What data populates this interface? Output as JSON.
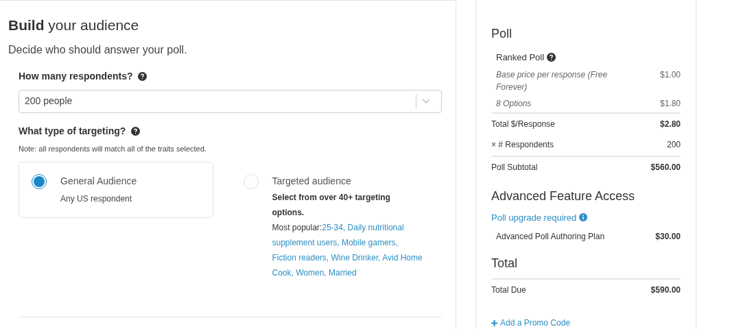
{
  "audience": {
    "title_bold": "Build",
    "title_rest": "your audience",
    "subtitle": "Decide who should answer your poll.",
    "respondents": {
      "label": "How many respondents?",
      "value": "200 people"
    },
    "targeting": {
      "label": "What type of targeting?",
      "note": "Note: all respondents will match all of the traits selected.",
      "options": [
        {
          "title": "General Audience",
          "selected": true,
          "lines": [
            {
              "kind": "plain",
              "text": "Any US respondent"
            }
          ]
        },
        {
          "title": "Targeted audience",
          "selected": false,
          "lines": [
            {
              "kind": "strong",
              "text": "Select from over 40+ targeting options."
            },
            {
              "kind": "popular",
              "label": "Most popular:",
              "text": "25-34, Daily nutritional supplement users, Mobile gamers, Fiction readers, Wine Drinker, Avid Home Cook, Women, Married"
            }
          ]
        }
      ]
    }
  },
  "summary": {
    "sections": [
      {
        "title": "Poll",
        "rows": [
          {
            "kind": "title",
            "label": "Ranked Poll"
          },
          {
            "kind": "item",
            "label": "Base price per response (Free Forever)",
            "value": "$1.00"
          },
          {
            "kind": "item",
            "label": "8 Options",
            "value": "$1.80"
          },
          {
            "kind": "total",
            "label": "Total $/Response",
            "value": "$2.80"
          },
          {
            "kind": "plain",
            "label": "× # Respondents",
            "value": "200"
          },
          {
            "kind": "total",
            "label": "Poll Subtotal",
            "value": "$560.00"
          }
        ]
      },
      {
        "title": "Advanced Feature Access",
        "link": "Poll upgrade required",
        "rows": [
          {
            "kind": "line",
            "label": "Advanced Poll Authoring Plan",
            "value": "$30.00"
          }
        ]
      },
      {
        "title": "Total",
        "rows": [
          {
            "kind": "total",
            "label": "Total Due",
            "value": "$590.00"
          }
        ]
      }
    ],
    "promo": "Add a Promo Code"
  }
}
